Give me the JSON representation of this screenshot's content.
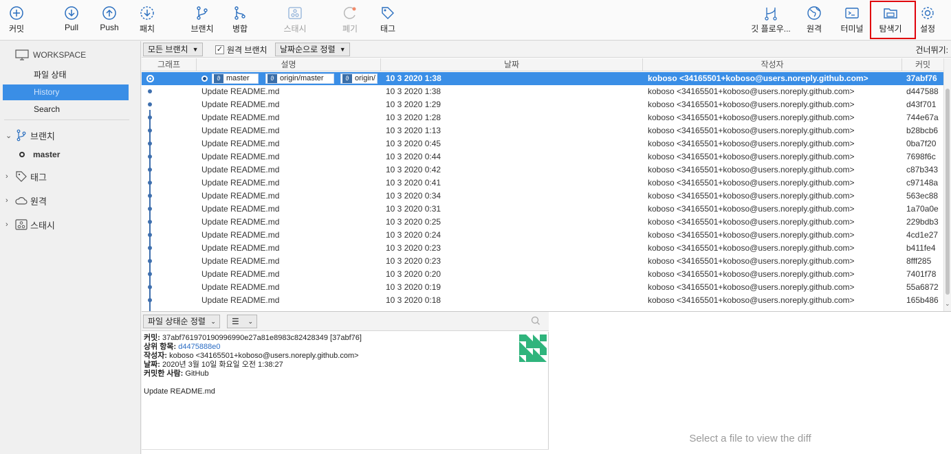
{
  "toolbar": {
    "commit": "커밋",
    "pull": "Pull",
    "push": "Push",
    "fetch": "패치",
    "branch": "브랜치",
    "merge": "병합",
    "stash": "스태시",
    "discard": "폐기",
    "tag": "태그",
    "gitflow": "깃 플로우...",
    "remote": "원격",
    "terminal": "터미널",
    "explorer": "탐색기",
    "settings": "설정"
  },
  "sidebar": {
    "workspace": "WORKSPACE",
    "file_status": "파일 상태",
    "history": "History",
    "search": "Search",
    "branches": "브랜치",
    "current_branch": "master",
    "tags": "태그",
    "remotes": "원격",
    "stashes": "스태시"
  },
  "filter": {
    "branches_dropdown": "모든 브랜치",
    "remote_branches_label": "원격 브랜치",
    "remote_branches_checked": true,
    "sort_dropdown": "날짜순으로 정렬",
    "skip": "건너뛰기:"
  },
  "columns": {
    "graph": "그래프",
    "description": "설명",
    "date": "날짜",
    "author": "작성자",
    "commit": "커밋"
  },
  "head_tags": [
    "master",
    "origin/master",
    "origin/"
  ],
  "commits": [
    {
      "msg": "",
      "date": "10 3 2020 1:38",
      "author": "koboso <34165501+koboso@users.noreply.github.com>",
      "hash": "37abf76"
    },
    {
      "msg": "Update README.md",
      "date": "10 3 2020 1:38",
      "author": "koboso <34165501+koboso@users.noreply.github.com>",
      "hash": "d447588"
    },
    {
      "msg": "Update README.md",
      "date": "10 3 2020 1:29",
      "author": "koboso <34165501+koboso@users.noreply.github.com>",
      "hash": "d43f701"
    },
    {
      "msg": "Update README.md",
      "date": "10 3 2020 1:28",
      "author": "koboso <34165501+koboso@users.noreply.github.com>",
      "hash": "744e67a"
    },
    {
      "msg": "Update README.md",
      "date": "10 3 2020 1:13",
      "author": "koboso <34165501+koboso@users.noreply.github.com>",
      "hash": "b28bcb6"
    },
    {
      "msg": "Update README.md",
      "date": "10 3 2020 0:45",
      "author": "koboso <34165501+koboso@users.noreply.github.com>",
      "hash": "0ba7f20"
    },
    {
      "msg": "Update README.md",
      "date": "10 3 2020 0:44",
      "author": "koboso <34165501+koboso@users.noreply.github.com>",
      "hash": "7698f6c"
    },
    {
      "msg": "Update README.md",
      "date": "10 3 2020 0:42",
      "author": "koboso <34165501+koboso@users.noreply.github.com>",
      "hash": "c87b343"
    },
    {
      "msg": "Update README.md",
      "date": "10 3 2020 0:41",
      "author": "koboso <34165501+koboso@users.noreply.github.com>",
      "hash": "c97148a"
    },
    {
      "msg": "Update README.md",
      "date": "10 3 2020 0:34",
      "author": "koboso <34165501+koboso@users.noreply.github.com>",
      "hash": "563ec88"
    },
    {
      "msg": "Update README.md",
      "date": "10 3 2020 0:31",
      "author": "koboso <34165501+koboso@users.noreply.github.com>",
      "hash": "1a70a0e"
    },
    {
      "msg": "Update README.md",
      "date": "10 3 2020 0:25",
      "author": "koboso <34165501+koboso@users.noreply.github.com>",
      "hash": "229bdb3"
    },
    {
      "msg": "Update README.md",
      "date": "10 3 2020 0:24",
      "author": "koboso <34165501+koboso@users.noreply.github.com>",
      "hash": "4cd1e27"
    },
    {
      "msg": "Update README.md",
      "date": "10 3 2020 0:23",
      "author": "koboso <34165501+koboso@users.noreply.github.com>",
      "hash": "b411fe4"
    },
    {
      "msg": "Update README.md",
      "date": "10 3 2020 0:23",
      "author": "koboso <34165501+koboso@users.noreply.github.com>",
      "hash": "8fff285"
    },
    {
      "msg": "Update README.md",
      "date": "10 3 2020 0:20",
      "author": "koboso <34165501+koboso@users.noreply.github.com>",
      "hash": "7401f78"
    },
    {
      "msg": "Update README.md",
      "date": "10 3 2020 0:19",
      "author": "koboso <34165501+koboso@users.noreply.github.com>",
      "hash": "55a6872"
    },
    {
      "msg": "Update README.md",
      "date": "10 3 2020 0:18",
      "author": "koboso <34165501+koboso@users.noreply.github.com>",
      "hash": "165b486"
    }
  ],
  "files": {
    "sort_dropdown": "파일 상태순 정렬",
    "view_dropdown": "☰"
  },
  "details": {
    "commit_label": "커밋:",
    "commit_value": "37abf761970190996990e27a81e8983c82428349 [37abf76]",
    "parent_label": "상위 항목:",
    "parent_value": "d4475888e0",
    "author_label": "작성자:",
    "author_value": "koboso <34165501+koboso@users.noreply.github.com>",
    "date_label": "날짜:",
    "date_value": "2020년 3월 10일 화요일 오전 1:38:27",
    "committer_label": "커밋한 사람:",
    "committer_value": "GitHub",
    "message": "Update README.md"
  },
  "diff": {
    "placeholder": "Select a file to view the diff"
  },
  "colors": {
    "accent": "#3a8ee6",
    "graph": "#3e6fae",
    "highlight_box": "#e0000b",
    "avatar": "#2fb47c"
  }
}
